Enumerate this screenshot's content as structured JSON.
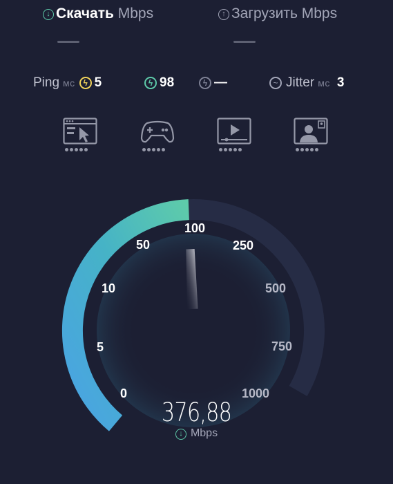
{
  "tabs": [
    {
      "label": "Скачать",
      "unit": "Mbps",
      "icon": "download-icon",
      "active": true
    },
    {
      "label": "Загрузить",
      "unit": "Mbps",
      "icon": "upload-icon",
      "active": false
    }
  ],
  "stats": {
    "ping": {
      "label": "Ping",
      "unit": "мс",
      "download_value": "5",
      "upload_value": "98",
      "idle_value": "—"
    },
    "jitter": {
      "label": "Jitter",
      "unit": "мс",
      "value": "3"
    }
  },
  "categories": [
    {
      "icon": "web-browsing-icon",
      "rating": 5
    },
    {
      "icon": "gaming-controller-icon",
      "rating": 5
    },
    {
      "icon": "video-streaming-icon",
      "rating": 5
    },
    {
      "icon": "video-call-icon",
      "rating": 5
    }
  ],
  "gauge": {
    "ticks": [
      "0",
      "5",
      "10",
      "50",
      "100",
      "250",
      "500",
      "750",
      "1000"
    ],
    "value": "376,88",
    "unit": "Mbps",
    "progress_fraction": 0.53
  },
  "colors": {
    "background": "#1c1f33",
    "accent_teal": "#5ecbaa",
    "accent_blue": "#4aa3e4",
    "ping_yellow": "#f1d35a",
    "gauge_track": "#262c45"
  }
}
